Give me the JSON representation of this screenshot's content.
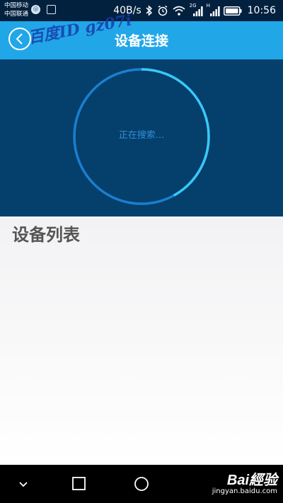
{
  "status_bar": {
    "carrier_1": "中国移动",
    "carrier_2": "中国联通",
    "network_speed": "40B/s",
    "network_2g": "2G",
    "network_h": "H",
    "time": "10:56"
  },
  "header": {
    "title": "设备连接",
    "watermark": "百度ID gz07i"
  },
  "scan": {
    "status_text": "正在搜索...",
    "progress": 0.42
  },
  "device_list": {
    "heading": "设备列表",
    "items": []
  },
  "footer_logo": {
    "brand": "Bai經验",
    "site": "jingyan.baidu.com"
  },
  "colors": {
    "status_bar": "#02213f",
    "title_bar": "#21a6e8",
    "scan_panel": "#053f6b",
    "ring": "#1a7fd0",
    "ring_highlight": "#39c8f5"
  }
}
